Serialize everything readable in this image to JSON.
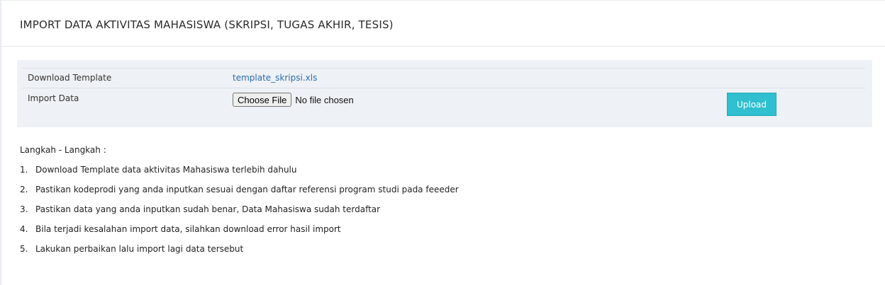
{
  "header": {
    "title": "IMPORT DATA AKTIVITAS MAHASISWA (SKRIPSI, TUGAS AKHIR, TESIS)"
  },
  "form": {
    "download_label": "Download Template",
    "template_link": "template_skripsi.xls",
    "import_label": "Import Data",
    "choose_file_label": "Choose File",
    "file_status": "No file chosen",
    "upload_label": "Upload"
  },
  "colors": {
    "accent": "#2fbfcf",
    "link": "#2a6bb0",
    "form_background": "#eef1f5"
  },
  "steps": {
    "heading": "Langkah - Langkah :",
    "items": [
      {
        "number": "1.",
        "text": "Download Template data aktivitas Mahasiswa terlebih dahulu"
      },
      {
        "number": "2.",
        "text": "Pastikan kodeprodi yang anda inputkan sesuai dengan daftar referensi program studi pada feeeder"
      },
      {
        "number": "3.",
        "text": "Pastikan data yang anda inputkan sudah benar, Data Mahasiswa sudah terdaftar"
      },
      {
        "number": "4.",
        "text": "Bila terjadi kesalahan import data, silahkan download error hasil import"
      },
      {
        "number": "5.",
        "text": "Lakukan perbaikan lalu import lagi data tersebut"
      }
    ]
  }
}
